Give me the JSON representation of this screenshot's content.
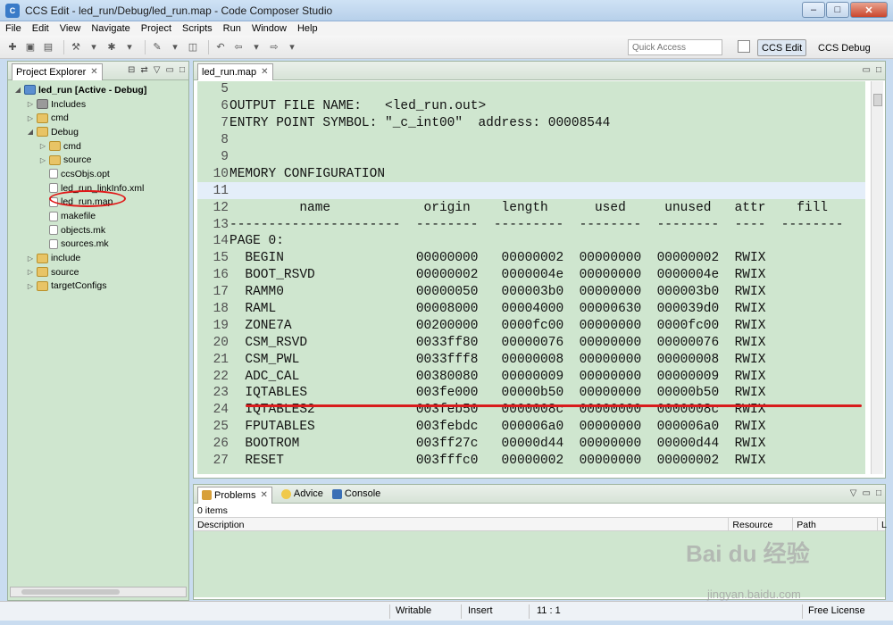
{
  "window": {
    "title": "CCS Edit - led_run/Debug/led_run.map - Code Composer Studio",
    "controls": [
      "–",
      "□",
      "✕"
    ]
  },
  "menu": [
    "File",
    "Edit",
    "View",
    "Navigate",
    "Project",
    "Scripts",
    "Run",
    "Window",
    "Help"
  ],
  "toolbar": {
    "quick_access_placeholder": "Quick Access",
    "perspectives": [
      "CCS Edit",
      "CCS Debug"
    ]
  },
  "explorer": {
    "tab_label": "Project Explorer",
    "items": [
      {
        "label": "led_run  [Active - Debug]",
        "type": "project",
        "level": 0,
        "expanded": true
      },
      {
        "label": "Includes",
        "type": "includes",
        "level": 1,
        "expanded": false
      },
      {
        "label": "cmd",
        "type": "folder",
        "level": 1,
        "expanded": false
      },
      {
        "label": "Debug",
        "type": "folder",
        "level": 1,
        "expanded": true
      },
      {
        "label": "cmd",
        "type": "folder",
        "level": 2,
        "expanded": false
      },
      {
        "label": "source",
        "type": "folder",
        "level": 2,
        "expanded": false
      },
      {
        "label": "ccsObjs.opt",
        "type": "file",
        "level": 2
      },
      {
        "label": "led_run_linkInfo.xml",
        "type": "file",
        "level": 2
      },
      {
        "label": "led_run.map",
        "type": "file",
        "level": 2,
        "selected": true
      },
      {
        "label": "makefile",
        "type": "file",
        "level": 2
      },
      {
        "label": "objects.mk",
        "type": "file",
        "level": 2
      },
      {
        "label": "sources.mk",
        "type": "file",
        "level": 2
      },
      {
        "label": "include",
        "type": "folder",
        "level": 1,
        "expanded": false
      },
      {
        "label": "source",
        "type": "folder",
        "level": 1,
        "expanded": false
      },
      {
        "label": "targetConfigs",
        "type": "folder",
        "level": 1,
        "expanded": false
      }
    ]
  },
  "editor": {
    "tab_label": "led_run.map",
    "lines": [
      {
        "n": "5",
        "t": ""
      },
      {
        "n": "6",
        "t": "OUTPUT FILE NAME:   <led_run.out>"
      },
      {
        "n": "7",
        "t": "ENTRY POINT SYMBOL: \"_c_int00\"  address: 00008544"
      },
      {
        "n": "8",
        "t": ""
      },
      {
        "n": "9",
        "t": ""
      },
      {
        "n": "10",
        "t": "MEMORY CONFIGURATION"
      },
      {
        "n": "11",
        "t": "",
        "current": true
      },
      {
        "n": "12",
        "t": "         name            origin    length      used     unused   attr    fill"
      },
      {
        "n": "13",
        "t": "----------------------  --------  ---------  --------  --------  ----  --------"
      },
      {
        "n": "14",
        "t": "PAGE 0:"
      },
      {
        "n": "15",
        "t": "  BEGIN                 00000000   00000002  00000000  00000002  RWIX"
      },
      {
        "n": "16",
        "t": "  BOOT_RSVD             00000002   0000004e  00000000  0000004e  RWIX"
      },
      {
        "n": "17",
        "t": "  RAMM0                 00000050   000003b0  00000000  000003b0  RWIX"
      },
      {
        "n": "18",
        "t": "  RAML                  00008000   00004000  00000630  000039d0  RWIX"
      },
      {
        "n": "19",
        "t": "  ZONE7A                00200000   0000fc00  00000000  0000fc00  RWIX"
      },
      {
        "n": "20",
        "t": "  CSM_RSVD              0033ff80   00000076  00000000  00000076  RWIX"
      },
      {
        "n": "21",
        "t": "  CSM_PWL               0033fff8   00000008  00000000  00000008  RWIX"
      },
      {
        "n": "22",
        "t": "  ADC_CAL               00380080   00000009  00000000  00000009  RWIX"
      },
      {
        "n": "23",
        "t": "  IQTABLES              003fe000   00000b50  00000000  00000b50  RWIX"
      },
      {
        "n": "24",
        "t": "  IQTABLES2             003feb50   0000008c  00000000  0000008c  RWIX"
      },
      {
        "n": "25",
        "t": "  FPUTABLES             003febdc   000006a0  00000000  000006a0  RWIX"
      },
      {
        "n": "26",
        "t": "  BOOTROM               003ff27c   00000d44  00000000  00000d44  RWIX"
      },
      {
        "n": "27",
        "t": "  RESET                 003fffc0   00000002  00000000  00000002  RWIX"
      }
    ]
  },
  "problems": {
    "tabs": [
      "Problems",
      "Advice",
      "Console"
    ],
    "items_count": "0 items",
    "columns": [
      "Description",
      "Resource",
      "Path",
      "L"
    ]
  },
  "status": {
    "writable": "Writable",
    "insert": "Insert",
    "position": "11 : 1",
    "license": "Free License"
  },
  "watermark": {
    "main": "Bai du 经验",
    "sub": "jingyan.baidu.com"
  },
  "colors": {
    "editor_bg": "#cfe6cf",
    "annotation_red": "#d81c1c",
    "titlebar": "#c4d9ef"
  }
}
